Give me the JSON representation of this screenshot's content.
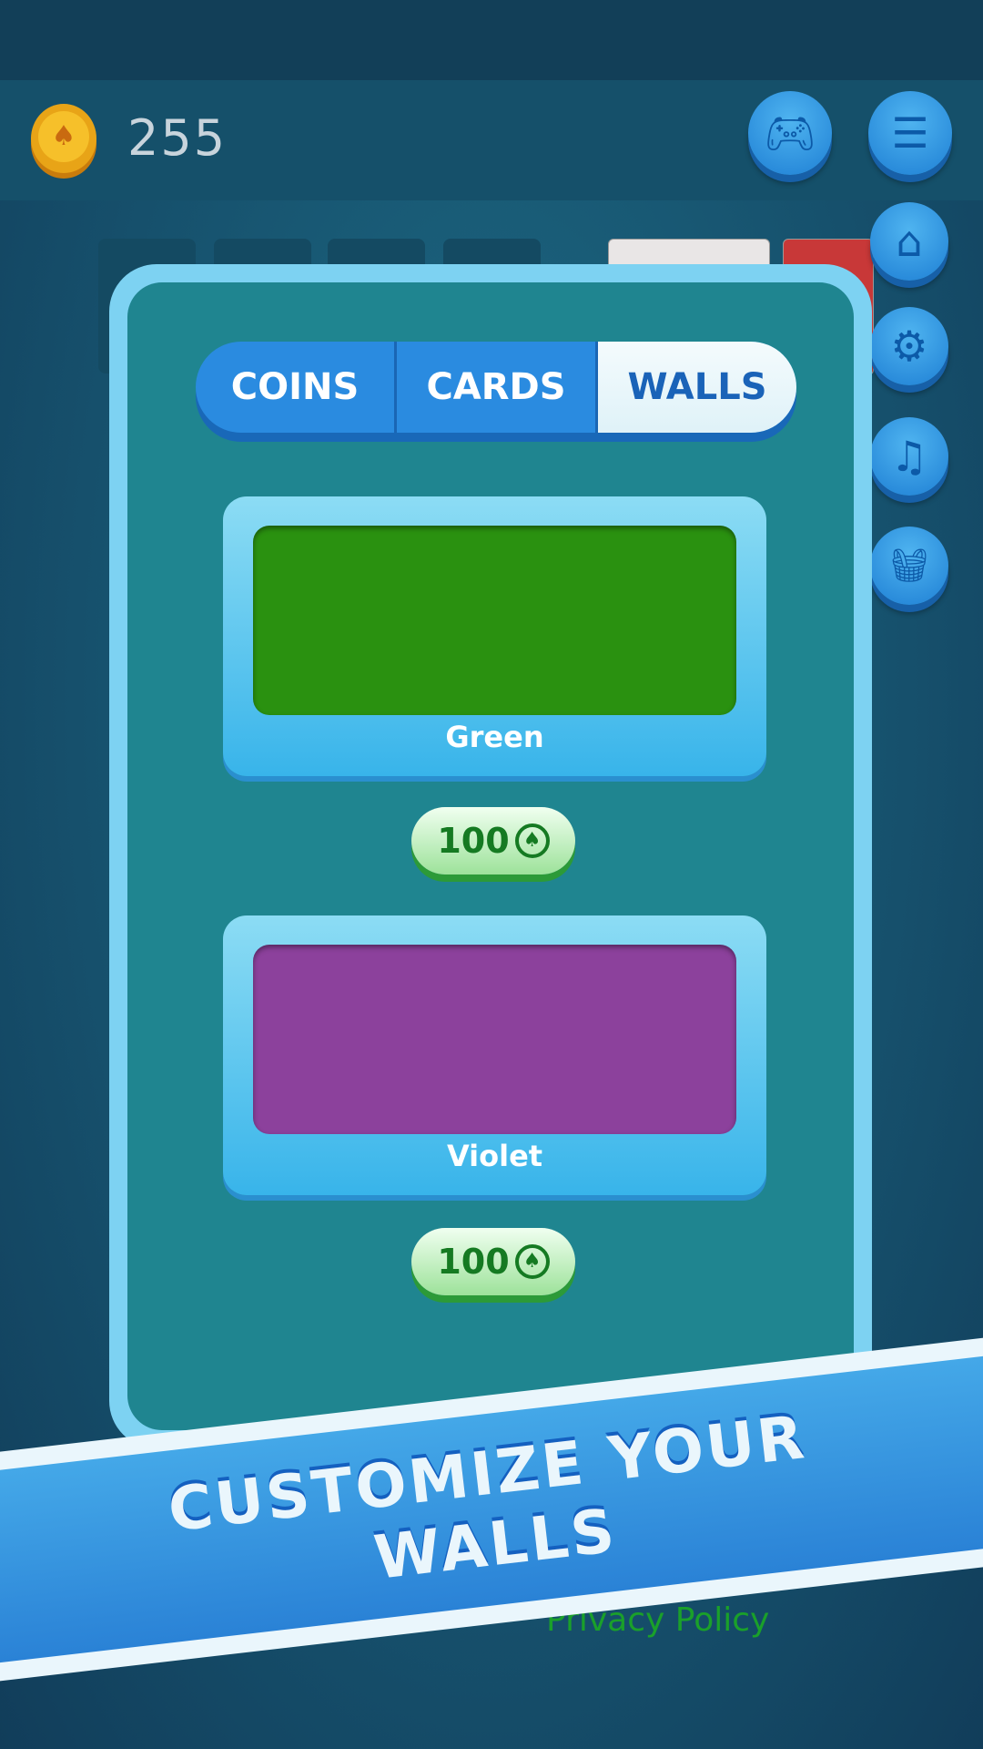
{
  "header": {
    "coins": "255"
  },
  "tabs": [
    {
      "label": "COINS"
    },
    {
      "label": "CARDS"
    },
    {
      "label": "WALLS",
      "active": true
    }
  ],
  "walls": [
    {
      "name": "Green",
      "color": "#2a9110",
      "price": "100"
    },
    {
      "name": "Violet",
      "color": "#8c419c",
      "price": "100"
    }
  ],
  "banner": {
    "line1": "CUSTOMIZE YOUR",
    "line2": "WALLS"
  },
  "footer": {
    "privacy": "Privacy Policy"
  },
  "icons": {
    "coin": "spade-coin-icon",
    "gamepad": "gamepad-icon",
    "menu": "menu-icon",
    "home": "home-icon",
    "settings": "gear-icon",
    "music": "music-icon",
    "shop": "basket-icon"
  }
}
